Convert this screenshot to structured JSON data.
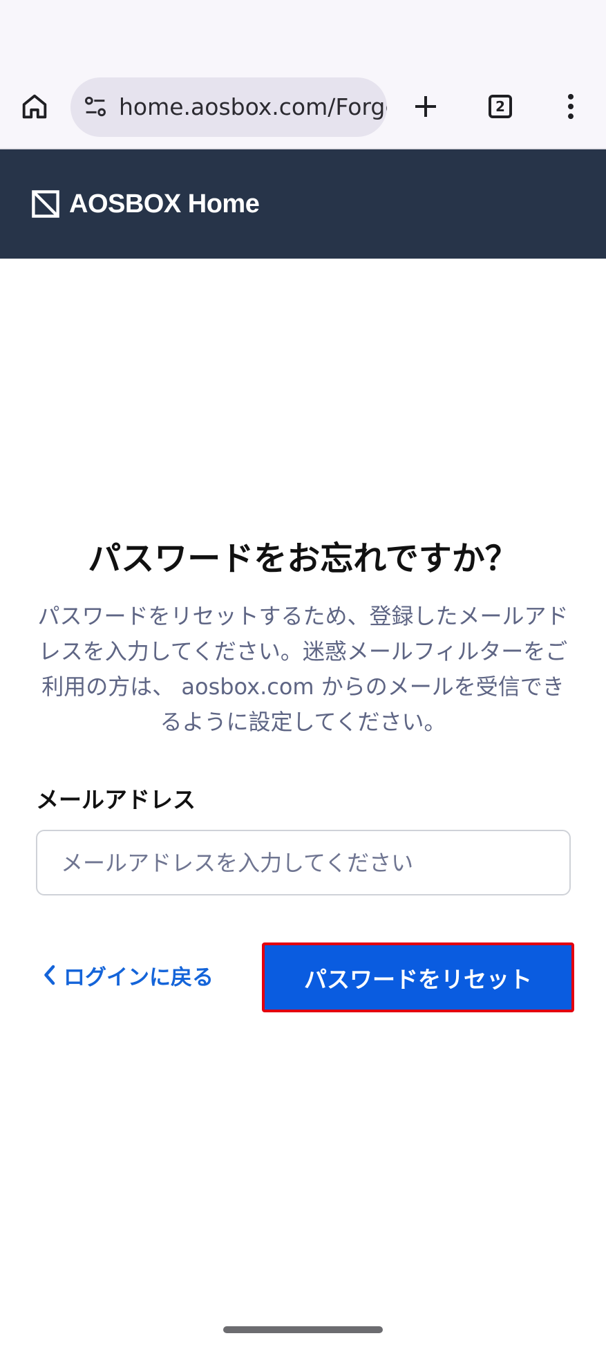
{
  "browser": {
    "url": "home.aosbox.com/Forge",
    "tab_count": "2"
  },
  "header": {
    "brand_name": "AOSBOX Home"
  },
  "page": {
    "title": "パスワードをお忘れですか？",
    "description": "パスワードをリセットするため、登録したメールアドレスを入力してください。迷惑メールフィルターをご利用の方は、 aosbox.com からのメールを受信できるように設定してください。",
    "email_label": "メールアドレス",
    "email_placeholder": "メールアドレスを入力してください",
    "email_value": "",
    "back_link": "ログインに戻る",
    "reset_button": "パスワードをリセット"
  },
  "colors": {
    "header_bg": "#273449",
    "primary_button": "#0a5ce0",
    "highlight_border": "#e3000f",
    "link": "#1464d9",
    "description_text": "#5e6584"
  },
  "icons": {
    "home": "home-icon",
    "site_info": "site-settings-icon",
    "new_tab": "plus-icon",
    "tabs": "tab-switcher-icon",
    "menu": "more-vert-icon",
    "logo": "aosbox-logo",
    "back": "chevron-left-icon"
  }
}
